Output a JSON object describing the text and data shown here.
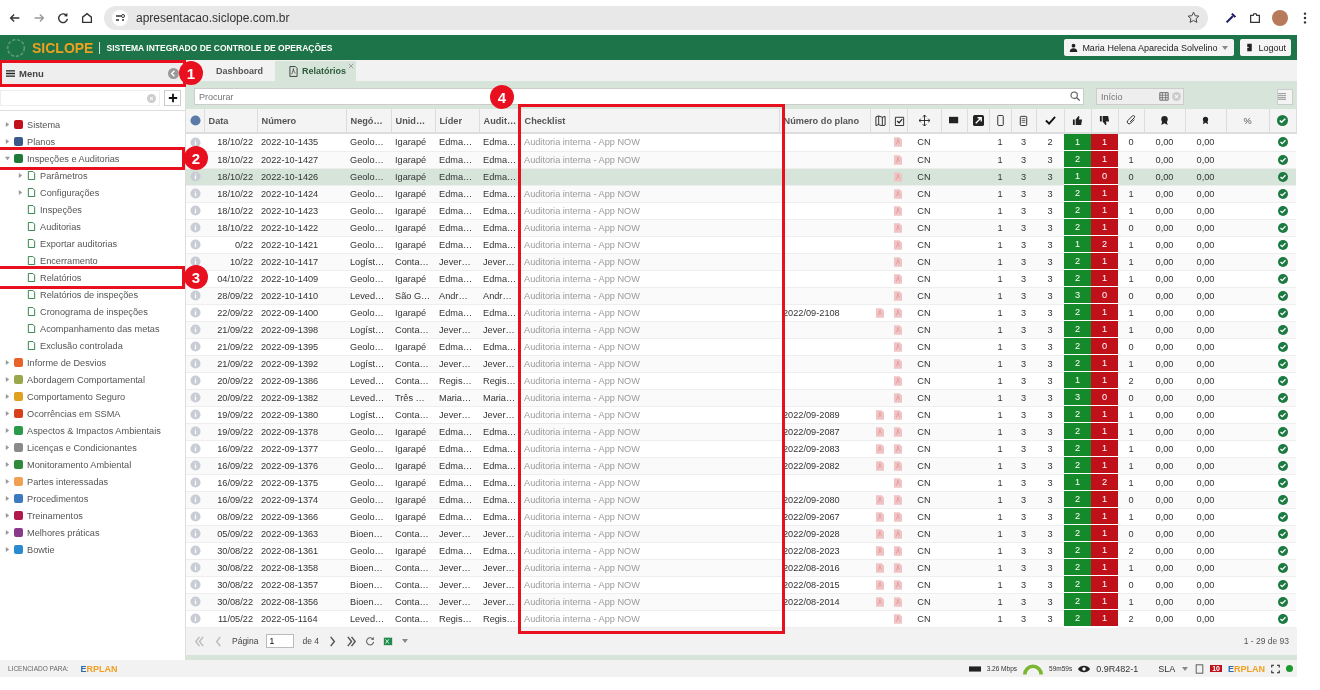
{
  "browser": {
    "url": "apresentacao.siclope.com.br"
  },
  "header": {
    "logo": "SICLOPE",
    "title": "SISTEMA INTEGRADO DE CONTROLE DE OPERAÇÕES",
    "user": "Maria Helena Aparecida Solvelino",
    "logout": "Logout"
  },
  "sidebar": {
    "title": "Menu",
    "callout": "1",
    "items": [
      {
        "label": "Sistema",
        "kind": "group",
        "expanded": false,
        "color": "#c0101a"
      },
      {
        "label": "Planos",
        "kind": "group",
        "expanded": false,
        "color": "#3a5a8c"
      },
      {
        "label": "Inspeções e Auditorias",
        "kind": "group",
        "expanded": true,
        "color": "#1f7a3a",
        "callout": "2",
        "children": [
          {
            "label": "Parâmetros",
            "kind": "group",
            "expanded": false
          },
          {
            "label": "Configurações",
            "kind": "group",
            "expanded": false
          },
          {
            "label": "Inspeções",
            "kind": "leaf"
          },
          {
            "label": "Auditorias",
            "kind": "leaf"
          },
          {
            "label": "Exportar auditorias",
            "kind": "leaf"
          },
          {
            "label": "Encerramento",
            "kind": "leaf"
          },
          {
            "label": "Relatórios",
            "kind": "leaf",
            "callout": "3"
          },
          {
            "label": "Relatórios de inspeções",
            "kind": "leaf"
          },
          {
            "label": "Cronograma de inspeções",
            "kind": "leaf"
          },
          {
            "label": "Acompanhamento das metas",
            "kind": "leaf"
          },
          {
            "label": "Exclusão controlada",
            "kind": "leaf"
          }
        ]
      },
      {
        "label": "Informe de Desvios",
        "kind": "group",
        "expanded": false,
        "color": "#e8632a"
      },
      {
        "label": "Abordagem Comportamental",
        "kind": "group",
        "expanded": false,
        "color": "#9aa84a"
      },
      {
        "label": "Comportamento Seguro",
        "kind": "group",
        "expanded": false,
        "color": "#e0a020"
      },
      {
        "label": "Ocorrências em SSMA",
        "kind": "group",
        "expanded": false,
        "color": "#d8401a"
      },
      {
        "label": "Aspectos & Impactos Ambientais",
        "kind": "group",
        "expanded": false,
        "color": "#2a9a4a"
      },
      {
        "label": "Licenças e Condicionantes",
        "kind": "group",
        "expanded": false,
        "color": "#8a8a8a"
      },
      {
        "label": "Monitoramento Ambiental",
        "kind": "group",
        "expanded": false,
        "color": "#2f8a3a"
      },
      {
        "label": "Partes interessadas",
        "kind": "group",
        "expanded": false,
        "color": "#f0a050"
      },
      {
        "label": "Procedimentos",
        "kind": "group",
        "expanded": false,
        "color": "#3a7ac0"
      },
      {
        "label": "Treinamentos",
        "kind": "group",
        "expanded": false,
        "color": "#b01a4a"
      },
      {
        "label": "Melhores práticas",
        "kind": "group",
        "expanded": false,
        "color": "#8a3a8a"
      },
      {
        "label": "Bowtie",
        "kind": "group",
        "expanded": false,
        "color": "#2a8ad0"
      }
    ]
  },
  "tabs": [
    {
      "label": "Dashboard",
      "selected": false,
      "closable": false
    },
    {
      "label": "Relatórios",
      "selected": true,
      "closable": true
    }
  ],
  "search": {
    "placeholder": "Procurar"
  },
  "date_filter": {
    "placeholder": "Início"
  },
  "table": {
    "columns": [
      {
        "label": "Data"
      },
      {
        "label": "Número"
      },
      {
        "label": "Negó…"
      },
      {
        "label": "Unid…"
      },
      {
        "label": "Líder"
      },
      {
        "label": "Audit…"
      },
      {
        "label": "Checklist",
        "callout": "4"
      },
      {
        "label": "Número do plano"
      },
      {
        "label": "%"
      }
    ],
    "rows": [
      {
        "date": "18/10/22",
        "number": "2022-10-1435",
        "business": "Geolo…",
        "unit": "Igarapé",
        "leader": "Edma…",
        "auditor": "Edma…",
        "checklist": "Auditoria interna - App NOW",
        "plan_report": false,
        "type": "CN",
        "c1": "1",
        "c2": "3",
        "c3": "2",
        "positive": "1",
        "negative": "1",
        "attachments": "0",
        "v1": "0,00",
        "v2": "0,00",
        "selected": false
      },
      {
        "date": "18/10/22",
        "number": "2022-10-1427",
        "business": "Geolo…",
        "unit": "Igarapé",
        "leader": "Edma…",
        "auditor": "Edma…",
        "checklist": "Auditoria interna - App NOW",
        "plan_report": false,
        "type": "CN",
        "c1": "1",
        "c2": "3",
        "c3": "3",
        "positive": "2",
        "negative": "1",
        "attachments": "1",
        "v1": "0,00",
        "v2": "0,00",
        "selected": false
      },
      {
        "date": "18/10/22",
        "number": "2022-10-1426",
        "business": "Geolo…",
        "unit": "Igarapé",
        "leader": "Edma…",
        "auditor": "Edma…",
        "plan_report": false,
        "type": "CN",
        "c1": "1",
        "c2": "3",
        "c3": "3",
        "positive": "1",
        "negative": "0",
        "attachments": "0",
        "v1": "0,00",
        "v2": "0,00",
        "selected": true
      },
      {
        "date": "18/10/22",
        "number": "2022-10-1424",
        "business": "Geolo…",
        "unit": "Igarapé",
        "leader": "Edma…",
        "auditor": "Edma…",
        "checklist": "Auditoria interna - App NOW",
        "plan_report": false,
        "type": "CN",
        "c1": "1",
        "c2": "3",
        "c3": "3",
        "positive": "2",
        "negative": "1",
        "attachments": "1",
        "v1": "0,00",
        "v2": "0,00",
        "selected": false
      },
      {
        "date": "18/10/22",
        "number": "2022-10-1423",
        "business": "Geolo…",
        "unit": "Igarapé",
        "leader": "Edma…",
        "auditor": "Edma…",
        "checklist": "Auditoria interna - App NOW",
        "plan_report": false,
        "type": "CN",
        "c1": "1",
        "c2": "3",
        "c3": "3",
        "positive": "2",
        "negative": "1",
        "attachments": "1",
        "v1": "0,00",
        "v2": "0,00",
        "selected": false
      },
      {
        "date": "18/10/22",
        "number": "2022-10-1422",
        "business": "Geolo…",
        "unit": "Igarapé",
        "leader": "Edma…",
        "auditor": "Edma…",
        "checklist": "Auditoria interna - App NOW",
        "plan_report": false,
        "type": "CN",
        "c1": "1",
        "c2": "3",
        "c3": "3",
        "positive": "2",
        "negative": "1",
        "attachments": "0",
        "v1": "0,00",
        "v2": "0,00",
        "selected": false
      },
      {
        "date": "0/22",
        "number": "2022-10-1421",
        "business": "Geolo…",
        "unit": "Igarapé",
        "leader": "Edma…",
        "auditor": "Edma…",
        "checklist": "Auditoria interna - App NOW",
        "plan_report": false,
        "type": "CN",
        "c1": "1",
        "c2": "3",
        "c3": "3",
        "positive": "1",
        "negative": "2",
        "attachments": "1",
        "v1": "0,00",
        "v2": "0,00",
        "selected": false
      },
      {
        "date": "10/22",
        "number": "2022-10-1417",
        "business": "Logíst…",
        "unit": "Conta…",
        "leader": "Jever…",
        "auditor": "Jever…",
        "checklist": "Auditoria interna - App NOW",
        "plan_report": false,
        "type": "CN",
        "c1": "1",
        "c2": "3",
        "c3": "3",
        "positive": "2",
        "negative": "1",
        "attachments": "1",
        "v1": "0,00",
        "v2": "0,00",
        "selected": false
      },
      {
        "date": "04/10/22",
        "number": "2022-10-1409",
        "business": "Geolo…",
        "unit": "Igarapé",
        "leader": "Edma…",
        "auditor": "Edma…",
        "checklist": "Auditoria interna - App NOW",
        "plan_report": false,
        "type": "CN",
        "c1": "1",
        "c2": "3",
        "c3": "3",
        "positive": "2",
        "negative": "1",
        "attachments": "1",
        "v1": "0,00",
        "v2": "0,00",
        "selected": false
      },
      {
        "date": "28/09/22",
        "number": "2022-10-1410",
        "business": "Leved…",
        "unit": "São G…",
        "leader": "Andr…",
        "auditor": "Andr…",
        "checklist": "Auditoria interna - App NOW",
        "plan_report": false,
        "type": "CN",
        "c1": "1",
        "c2": "3",
        "c3": "3",
        "positive": "3",
        "negative": "0",
        "attachments": "0",
        "v1": "0,00",
        "v2": "0,00",
        "selected": false
      },
      {
        "date": "22/09/22",
        "number": "2022-09-1400",
        "business": "Geolo…",
        "unit": "Igarapé",
        "leader": "Edma…",
        "auditor": "Edma…",
        "checklist": "Auditoria interna - App NOW",
        "plan": "2022/09-2108",
        "plan_report": true,
        "type": "CN",
        "c1": "1",
        "c2": "3",
        "c3": "3",
        "positive": "2",
        "negative": "1",
        "attachments": "1",
        "v1": "0,00",
        "v2": "0,00",
        "selected": false
      },
      {
        "date": "21/09/22",
        "number": "2022-09-1398",
        "business": "Logíst…",
        "unit": "Conta…",
        "leader": "Jever…",
        "auditor": "Jever…",
        "checklist": "Auditoria interna - App NOW",
        "plan_report": false,
        "type": "CN",
        "c1": "1",
        "c2": "3",
        "c3": "3",
        "positive": "2",
        "negative": "1",
        "attachments": "1",
        "v1": "0,00",
        "v2": "0,00",
        "selected": false
      },
      {
        "date": "21/09/22",
        "number": "2022-09-1395",
        "business": "Geolo…",
        "unit": "Igarapé",
        "leader": "Edma…",
        "auditor": "Edma…",
        "checklist": "Auditoria interna - App NOW",
        "plan_report": false,
        "type": "CN",
        "c1": "1",
        "c2": "3",
        "c3": "3",
        "positive": "2",
        "negative": "0",
        "attachments": "0",
        "v1": "0,00",
        "v2": "0,00",
        "selected": false
      },
      {
        "date": "21/09/22",
        "number": "2022-09-1392",
        "business": "Logíst…",
        "unit": "Conta…",
        "leader": "Jever…",
        "auditor": "Jever…",
        "checklist": "Auditoria interna - App NOW",
        "plan_report": false,
        "type": "CN",
        "c1": "1",
        "c2": "3",
        "c3": "3",
        "positive": "2",
        "negative": "1",
        "attachments": "1",
        "v1": "0,00",
        "v2": "0,00",
        "selected": false
      },
      {
        "date": "20/09/22",
        "number": "2022-09-1386",
        "business": "Leved…",
        "unit": "Conta…",
        "leader": "Regis…",
        "auditor": "Regis…",
        "checklist": "Auditoria interna - App NOW",
        "plan_report": false,
        "type": "CN",
        "c1": "1",
        "c2": "3",
        "c3": "3",
        "positive": "1",
        "negative": "1",
        "attachments": "2",
        "v1": "0,00",
        "v2": "0,00",
        "selected": false
      },
      {
        "date": "20/09/22",
        "number": "2022-09-1382",
        "business": "Leved…",
        "unit": "Três …",
        "leader": "Maria…",
        "auditor": "Maria…",
        "checklist": "Auditoria interna - App NOW",
        "plan_report": false,
        "type": "CN",
        "c1": "1",
        "c2": "3",
        "c3": "3",
        "positive": "3",
        "negative": "0",
        "attachments": "0",
        "v1": "0,00",
        "v2": "0,00",
        "selected": false
      },
      {
        "date": "19/09/22",
        "number": "2022-09-1380",
        "business": "Logíst…",
        "unit": "Conta…",
        "leader": "Jever…",
        "auditor": "Jever…",
        "checklist": "Auditoria interna - App NOW",
        "plan": "2022/09-2089",
        "plan_report": true,
        "type": "CN",
        "c1": "1",
        "c2": "3",
        "c3": "3",
        "positive": "2",
        "negative": "1",
        "attachments": "1",
        "v1": "0,00",
        "v2": "0,00",
        "selected": false
      },
      {
        "date": "19/09/22",
        "number": "2022-09-1378",
        "business": "Geolo…",
        "unit": "Igarapé",
        "leader": "Edma…",
        "auditor": "Edma…",
        "checklist": "Auditoria interna - App NOW",
        "plan": "2022/09-2087",
        "plan_report": true,
        "type": "CN",
        "c1": "1",
        "c2": "3",
        "c3": "3",
        "positive": "2",
        "negative": "1",
        "attachments": "1",
        "v1": "0,00",
        "v2": "0,00",
        "selected": false
      },
      {
        "date": "16/09/22",
        "number": "2022-09-1377",
        "business": "Geolo…",
        "unit": "Igarapé",
        "leader": "Edma…",
        "auditor": "Edma…",
        "checklist": "Auditoria interna - App NOW",
        "plan": "2022/09-2083",
        "plan_report": true,
        "type": "CN",
        "c1": "1",
        "c2": "3",
        "c3": "3",
        "positive": "2",
        "negative": "1",
        "attachments": "1",
        "v1": "0,00",
        "v2": "0,00",
        "selected": false
      },
      {
        "date": "16/09/22",
        "number": "2022-09-1376",
        "business": "Geolo…",
        "unit": "Igarapé",
        "leader": "Edma…",
        "auditor": "Edma…",
        "checklist": "Auditoria interna - App NOW",
        "plan": "2022/09-2082",
        "plan_report": true,
        "type": "CN",
        "c1": "1",
        "c2": "3",
        "c3": "3",
        "positive": "2",
        "negative": "1",
        "attachments": "1",
        "v1": "0,00",
        "v2": "0,00",
        "selected": false
      },
      {
        "date": "16/09/22",
        "number": "2022-09-1375",
        "business": "Geolo…",
        "unit": "Igarapé",
        "leader": "Edma…",
        "auditor": "Edma…",
        "checklist": "Auditoria interna - App NOW",
        "plan_report": false,
        "type": "CN",
        "c1": "1",
        "c2": "3",
        "c3": "3",
        "positive": "1",
        "negative": "2",
        "attachments": "1",
        "v1": "0,00",
        "v2": "0,00",
        "selected": false
      },
      {
        "date": "16/09/22",
        "number": "2022-09-1374",
        "business": "Geolo…",
        "unit": "Igarapé",
        "leader": "Edma…",
        "auditor": "Edma…",
        "checklist": "Auditoria interna - App NOW",
        "plan": "2022/09-2080",
        "plan_report": true,
        "type": "CN",
        "c1": "1",
        "c2": "3",
        "c3": "3",
        "positive": "2",
        "negative": "1",
        "attachments": "0",
        "v1": "0,00",
        "v2": "0,00",
        "selected": false
      },
      {
        "date": "08/09/22",
        "number": "2022-09-1366",
        "business": "Geolo…",
        "unit": "Igarapé",
        "leader": "Edma…",
        "auditor": "Edma…",
        "checklist": "Auditoria interna - App NOW",
        "plan": "2022/09-2067",
        "plan_report": true,
        "type": "CN",
        "c1": "1",
        "c2": "3",
        "c3": "3",
        "positive": "2",
        "negative": "1",
        "attachments": "1",
        "v1": "0,00",
        "v2": "0,00",
        "selected": false
      },
      {
        "date": "05/09/22",
        "number": "2022-09-1363",
        "business": "Bioen…",
        "unit": "Conta…",
        "leader": "Jever…",
        "auditor": "Jever…",
        "checklist": "Auditoria interna - App NOW",
        "plan": "2022/09-2028",
        "plan_report": true,
        "type": "CN",
        "c1": "1",
        "c2": "3",
        "c3": "3",
        "positive": "2",
        "negative": "1",
        "attachments": "0",
        "v1": "0,00",
        "v2": "0,00",
        "selected": false
      },
      {
        "date": "30/08/22",
        "number": "2022-08-1361",
        "business": "Geolo…",
        "unit": "Igarapé",
        "leader": "Edma…",
        "auditor": "Edma…",
        "checklist": "Auditoria interna - App NOW",
        "plan": "2022/08-2023",
        "plan_report": true,
        "type": "CN",
        "c1": "1",
        "c2": "3",
        "c3": "3",
        "positive": "2",
        "negative": "1",
        "attachments": "2",
        "v1": "0,00",
        "v2": "0,00",
        "selected": false
      },
      {
        "date": "30/08/22",
        "number": "2022-08-1358",
        "business": "Bioen…",
        "unit": "Conta…",
        "leader": "Jever…",
        "auditor": "Jever…",
        "checklist": "Auditoria interna - App NOW",
        "plan": "2022/08-2016",
        "plan_report": true,
        "type": "CN",
        "c1": "1",
        "c2": "3",
        "c3": "3",
        "positive": "2",
        "negative": "1",
        "attachments": "1",
        "v1": "0,00",
        "v2": "0,00",
        "selected": false
      },
      {
        "date": "30/08/22",
        "number": "2022-08-1357",
        "business": "Bioen…",
        "unit": "Conta…",
        "leader": "Jever…",
        "auditor": "Jever…",
        "checklist": "Auditoria interna - App NOW",
        "plan": "2022/08-2015",
        "plan_report": true,
        "type": "CN",
        "c1": "1",
        "c2": "3",
        "c3": "3",
        "positive": "2",
        "negative": "1",
        "attachments": "0",
        "v1": "0,00",
        "v2": "0,00",
        "selected": false
      },
      {
        "date": "30/08/22",
        "number": "2022-08-1356",
        "business": "Bioen…",
        "unit": "Conta…",
        "leader": "Jever…",
        "auditor": "Jever…",
        "checklist": "Auditoria interna - App NOW",
        "plan": "2022/08-2014",
        "plan_report": true,
        "type": "CN",
        "c1": "1",
        "c2": "3",
        "c3": "3",
        "positive": "2",
        "negative": "1",
        "attachments": "1",
        "v1": "0,00",
        "v2": "0,00",
        "selected": false
      },
      {
        "date": "11/05/22",
        "number": "2022-05-1164",
        "business": "Leved…",
        "unit": "Conta…",
        "leader": "Regis…",
        "auditor": "Regis…",
        "checklist": "Auditoria interna - App NOW",
        "plan_report": false,
        "type": "CN",
        "c1": "1",
        "c2": "3",
        "c3": "3",
        "positive": "2",
        "negative": "1",
        "attachments": "2",
        "v1": "0,00",
        "v2": "0,00",
        "selected": false
      }
    ]
  },
  "pager": {
    "page_label": "Página",
    "page": "1",
    "of": "de 4",
    "summary": "1 - 29 de 93"
  },
  "status_bar": {
    "licensed": "LICENCIADO PARA:",
    "brand": "ERPLAN",
    "speed": "3.26 Mbps",
    "timer": "59m59s",
    "version": "0.9R482-1",
    "sla": "SLA",
    "notifications": "10",
    "vendor": "ERPLAN"
  }
}
